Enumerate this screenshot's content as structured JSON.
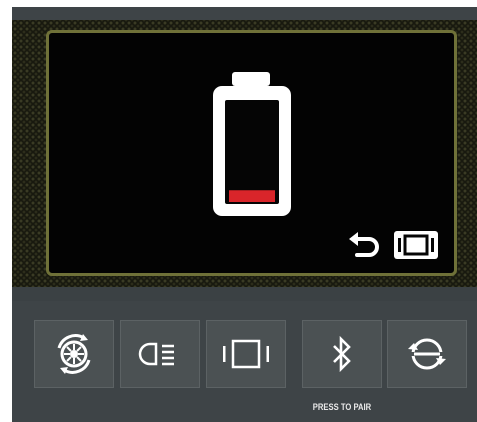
{
  "screen": {
    "battery_level": 0.12,
    "battery_level_color": "#d9252a",
    "frame_color": "#6f7138"
  },
  "buttons": [
    {
      "icon": "wheel-rotate-icon"
    },
    {
      "icon": "headlight-icon"
    },
    {
      "icon": "screen-mode-icon"
    },
    {
      "icon": "bluetooth-icon",
      "label": "PRESS TO PAIR"
    },
    {
      "icon": "sync-cycle-icon"
    }
  ]
}
